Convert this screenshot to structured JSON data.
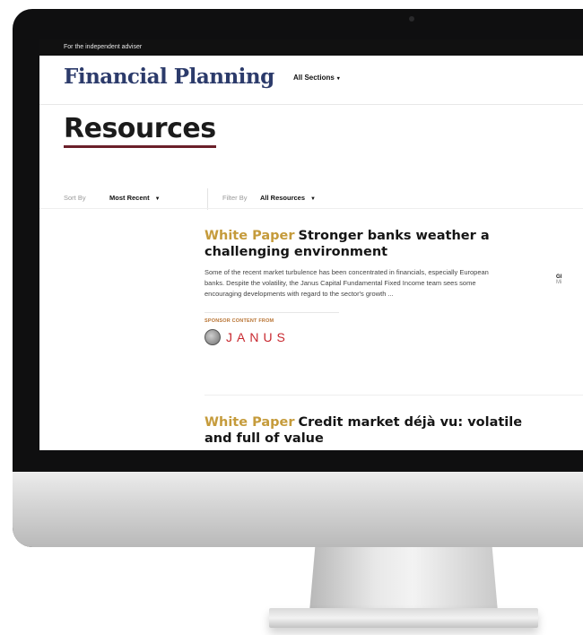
{
  "site": {
    "tagline": "For the independent adviser",
    "logo": "Financial Planning",
    "sections_label": "All Sections"
  },
  "page": {
    "title": "Resources"
  },
  "controls": {
    "sort_label": "Sort By",
    "sort_value": "Most Recent",
    "filter_label": "Filter By",
    "filter_value": "All Resources"
  },
  "articles": [
    {
      "kind": "White Paper",
      "title": "Stronger banks weather a challenging environment",
      "description": "Some of the recent market turbulence has been concentrated in financials, especially European banks. Despite the volatility, the Janus Capital Fundamental Fixed Income team sees some encouraging developments with regard to the sector's growth ...",
      "sponsor_label": "SPONSOR CONTENT FROM",
      "sponsor_name": "JANUS"
    },
    {
      "kind": "White Paper",
      "title": "Credit market déjà vu: volatile and full of value"
    }
  ],
  "right_teaser": {
    "line1": "Gl",
    "line2": "Mi"
  },
  "colors": {
    "brand_navy": "#2c3b6b",
    "accent_gold": "#c59b3b",
    "title_underline": "#6b1f2a",
    "sponsor_red": "#c8282f"
  }
}
